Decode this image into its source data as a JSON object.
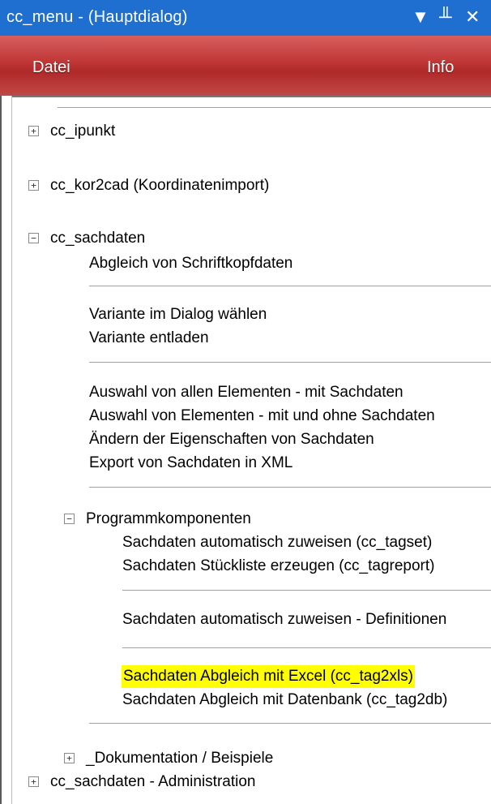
{
  "window": {
    "title": "cc_menu - (Hauptdialog)",
    "buttons": {
      "dropdown": "▼",
      "pin": "╨",
      "close": "✕"
    }
  },
  "menubar": {
    "file": "Datei",
    "info": "Info"
  },
  "tree": {
    "cc_ipunkt": "cc_ipunkt",
    "cc_kor2cad": "cc_kor2cad (Koordinatenimport)",
    "cc_sachdaten": "cc_sachdaten",
    "abgleich_schriftkopf": "Abgleich von Schriftkopfdaten",
    "variante_waehlen": "Variante im Dialog wählen",
    "variante_entladen": "Variante entladen",
    "auswahl_allen": "Auswahl von allen Elementen - mit Sachdaten",
    "auswahl_elementen": "Auswahl von Elementen - mit und ohne Sachdaten",
    "aendern_eigenschaften": "Ändern der Eigenschaften von Sachdaten",
    "export_xml": "Export von Sachdaten in XML",
    "programmkomponenten": "Programmkomponenten",
    "tagset": "Sachdaten automatisch zuweisen (cc_tagset)",
    "tagreport": "Sachdaten Stückliste erzeugen (cc_tagreport)",
    "definitionen": "Sachdaten automatisch zuweisen - Definitionen",
    "tag2xls": "Sachdaten Abgleich mit Excel (cc_tag2xls)",
    "tag2db": "Sachdaten Abgleich mit Datenbank (cc_tag2db)",
    "dokumentation": "_Dokumentation / Beispiele",
    "administration": "cc_sachdaten - Administration"
  },
  "expanders": {
    "plus": "+",
    "minus": "−"
  },
  "colors": {
    "titlebar": "#1f6fd0",
    "menubar": "#c23a3a",
    "highlight": "#ffff00"
  }
}
